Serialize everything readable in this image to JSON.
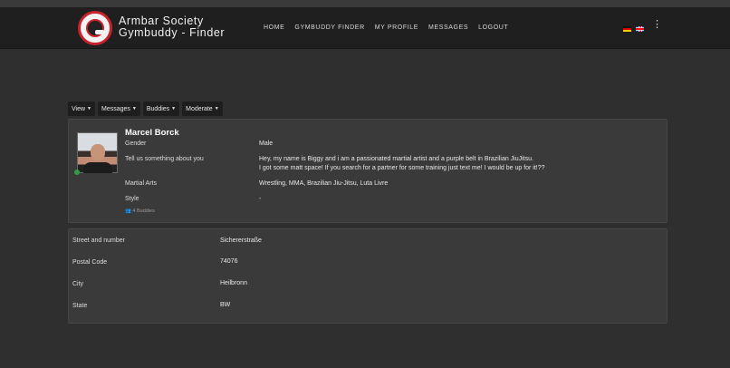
{
  "header": {
    "brand_line1": "Armbar Society",
    "brand_line2": "Gymbuddy - Finder",
    "nav": [
      "HOME",
      "GYMBUDDY FINDER",
      "MY PROFILE",
      "MESSAGES",
      "LOGOUT"
    ],
    "menu_icon": "⋮"
  },
  "toolbar": [
    "View",
    "Messages",
    "Buddies",
    "Moderate"
  ],
  "profile": {
    "name": "Marcel Borck",
    "gender_label": "Gender",
    "gender": "Male",
    "about_label": "Tell us something about you",
    "about_line1": "Hey, my name is Biggy and i am a passionated martial artist and a purple belt in Brazilian JiuJitsu.",
    "about_line2": "I got some matt space! If you search for a partner for some training just text me! I would be up for it!??",
    "arts_label": "Martial Arts",
    "arts": "Wrestling, MMA, Brazilian Jiu-Jitsu, Luta Livre",
    "style_label": "Style",
    "style": "-",
    "buddies": "👥 4 Buddies"
  },
  "address": [
    {
      "label": "Street and number",
      "value": "Sichererstraße"
    },
    {
      "label": "Postal Code",
      "value": "74076"
    },
    {
      "label": "City",
      "value": "Heilbronn"
    },
    {
      "label": "State",
      "value": "BW"
    }
  ]
}
